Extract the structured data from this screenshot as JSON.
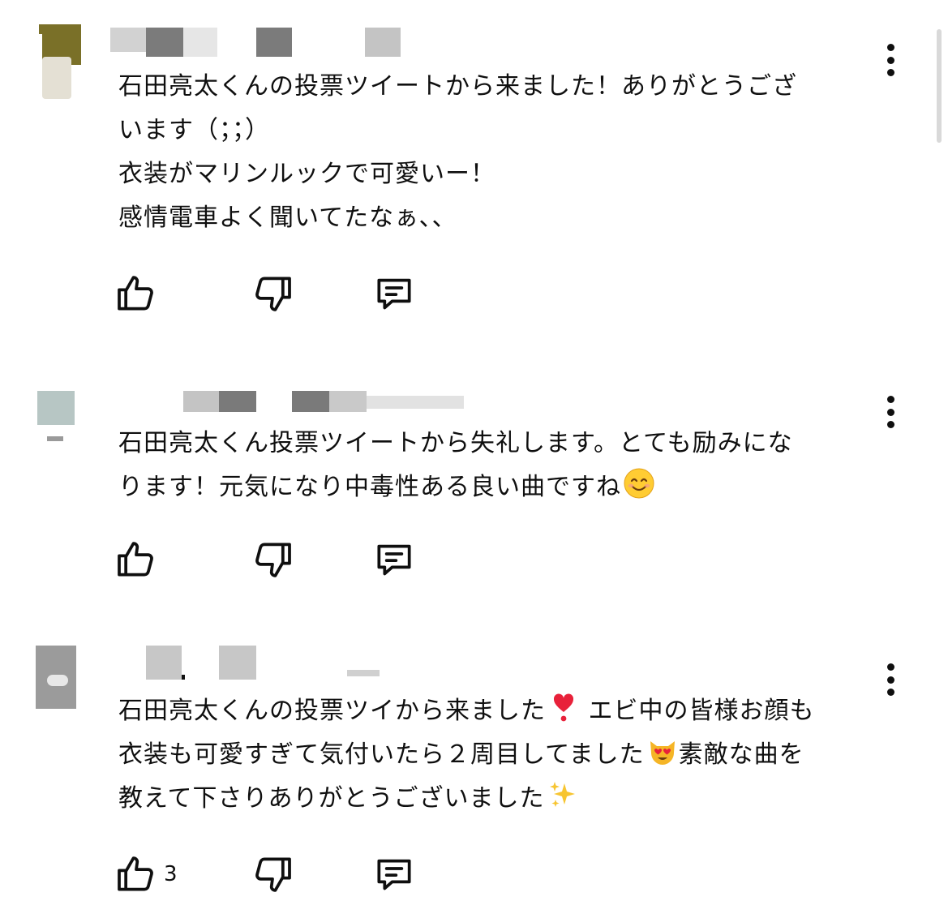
{
  "comments": [
    {
      "text": "石田亮太くんの投票ツイートから来ました！ありがとうござ\nいます（；；）\n衣装がマリンルックで可愛いー！\n感情電車よく聞いてたなぁ、、",
      "like_count": "",
      "like_icon": "thumbs-up-icon",
      "dislike_icon": "thumbs-down-icon",
      "reply_icon": "reply-comment-icon",
      "menu_icon": "more-vert-icon"
    },
    {
      "text": "石田亮太くん投票ツイートから失礼します。とても励みにな\nります！元気になり中毒性ある良い曲ですね",
      "emoji_end": "smiling-face-emoji",
      "like_count": "",
      "like_icon": "thumbs-up-icon",
      "dislike_icon": "thumbs-down-icon",
      "reply_icon": "reply-comment-icon",
      "menu_icon": "more-vert-icon"
    },
    {
      "text_parts": {
        "line1a": "石田亮太くんの投票ツイから来ました",
        "line1b": "エビ中の皆様お顔も",
        "line2a": "衣装も可愛すぎて気付いたら２周目してました",
        "line2b": "素敵な曲を",
        "line3a": "教えて下さりありがとうございました"
      },
      "emojis": [
        "heart-exclamation-emoji",
        "heart-eyes-cat-emoji",
        "sparkles-emoji"
      ],
      "like_count": "3",
      "like_icon": "thumbs-up-icon",
      "dislike_icon": "thumbs-down-icon",
      "reply_icon": "reply-comment-icon",
      "menu_icon": "more-vert-icon"
    }
  ]
}
